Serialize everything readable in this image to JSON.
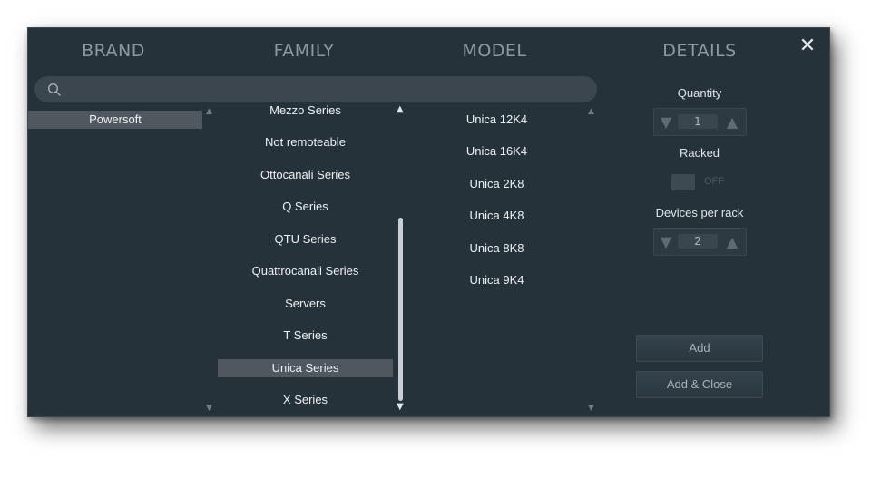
{
  "headers": {
    "brand": "BRAND",
    "family": "FAMILY",
    "model": "MODEL",
    "details": "DETAILS"
  },
  "close_icon": "✕",
  "search": {
    "value": "",
    "placeholder": "",
    "icon": "search-icon"
  },
  "brands": [
    {
      "label": "Powersoft",
      "selected": true
    }
  ],
  "families": [
    {
      "label": "Mezzo Series",
      "selected": false
    },
    {
      "label": "Not remoteable",
      "selected": false
    },
    {
      "label": "Ottocanali Series",
      "selected": false
    },
    {
      "label": "Q Series",
      "selected": false
    },
    {
      "label": "QTU Series",
      "selected": false
    },
    {
      "label": "Quattrocanali Series",
      "selected": false
    },
    {
      "label": "Servers",
      "selected": false
    },
    {
      "label": "T Series",
      "selected": false
    },
    {
      "label": "Unica Series",
      "selected": true
    },
    {
      "label": "X Series",
      "selected": false
    }
  ],
  "models": [
    {
      "label": "Unica 12K4"
    },
    {
      "label": "Unica 16K4"
    },
    {
      "label": "Unica 2K8"
    },
    {
      "label": "Unica 4K8"
    },
    {
      "label": "Unica 8K8"
    },
    {
      "label": "Unica 9K4"
    }
  ],
  "details": {
    "quantity_label": "Quantity",
    "quantity_value": "1",
    "racked_label": "Racked",
    "racked_state": "OFF",
    "devices_per_rack_label": "Devices per rack",
    "devices_per_rack_value": "2",
    "decrement_glyph": "▼",
    "increment_glyph": "▲"
  },
  "buttons": {
    "add": "Add",
    "add_close": "Add & Close"
  },
  "arrows": {
    "up": "▲",
    "down": "▼"
  },
  "colors": {
    "dialog_bg": "#26323a",
    "header_text": "#8e989e",
    "selected_row": "#4e585e",
    "search_bg": "#3b464e"
  }
}
